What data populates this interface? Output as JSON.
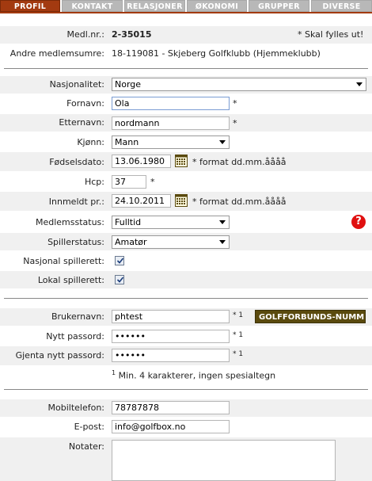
{
  "tabs": [
    {
      "label": "PROFIL",
      "active": true
    },
    {
      "label": "KONTAKT",
      "active": false
    },
    {
      "label": "RELASJONER",
      "active": false
    },
    {
      "label": "ØKONOMI",
      "active": false
    },
    {
      "label": "GRUPPER",
      "active": false
    },
    {
      "label": "DIVERSE",
      "active": false
    }
  ],
  "member": {
    "nr_label": "Medl.nr.:",
    "nr_value": "2-35015",
    "required_note": "* Skal fylles ut!",
    "other_label": "Andre medlemsumre:",
    "other_value": "18-119081 - Skjeberg Golfklubb (Hjemmeklubb)"
  },
  "form": {
    "nationality_label": "Nasjonalitet:",
    "nationality_value": "Norge",
    "firstname_label": "Fornavn:",
    "firstname_value": "Ola",
    "lastname_label": "Etternavn:",
    "lastname_value": "nordmann",
    "gender_label": "Kjønn:",
    "gender_value": "Mann",
    "birth_label": "Fødselsdato:",
    "birth_value": "13.06.1980",
    "date_format_note": "* format dd.mm.åååå",
    "hcp_label": "Hcp:",
    "hcp_value": "37",
    "joined_label": "Innmeldt pr.:",
    "joined_value": "24.10.2011",
    "status_label": "Medlemsstatus:",
    "status_value": "Fulltid",
    "player_status_label": "Spillerstatus:",
    "player_status_value": "Amatør",
    "national_label": "Nasjonal spillerett:",
    "national_checked": true,
    "local_label": "Lokal spillerett:",
    "local_checked": true,
    "required_star": "*",
    "help_symbol": "?"
  },
  "account": {
    "username_label": "Brukernavn:",
    "username_value": "phtest",
    "new_pw_label": "Nytt passord:",
    "new_pw_value": "••••••",
    "repeat_pw_label": "Gjenta nytt passord:",
    "repeat_pw_value": "••••••",
    "star_footnote": "* 1",
    "golf_button": "GOLFFORBUNDS-NUMME",
    "footnote_sup": "1",
    "footnote_text": " Min. 4 karakterer, ingen spesialtegn"
  },
  "contact": {
    "mobile_label": "Mobiltelefon:",
    "mobile_value": "78787878",
    "email_label": "E-post:",
    "email_value": "info@golfbox.no",
    "notes_label": "Notater:"
  }
}
